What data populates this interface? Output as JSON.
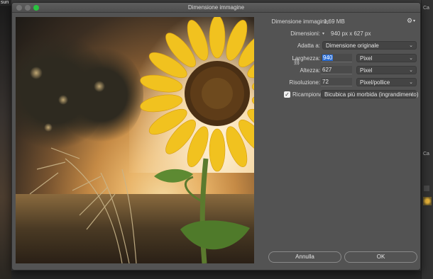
{
  "background": {
    "doc_tab": "sun",
    "right_panel": {
      "tab_top": "Ca",
      "tab_mid": "Ca"
    }
  },
  "dialog": {
    "title": "Dimensione immagine",
    "image_size": {
      "label": "Dimensione immagine:",
      "value": "1,69 MB"
    },
    "dimensions": {
      "label": "Dimensioni:",
      "value": "940 px x 627 px"
    },
    "fit_to": {
      "label": "Adatta a:",
      "selected": "Dimensione originale"
    },
    "width": {
      "label": "Larghezza:",
      "value": "940",
      "unit": "Pixel"
    },
    "height": {
      "label": "Altezza:",
      "value": "627",
      "unit": "Pixel"
    },
    "resolution": {
      "label": "Risoluzione:",
      "value": "72",
      "unit": "Pixel/pollice"
    },
    "resample": {
      "label": "Ricampiona:",
      "checked": true,
      "selected": "Bicubica più morbida (ingrandimento)"
    },
    "buttons": {
      "cancel": "Annulla",
      "ok": "OK"
    }
  },
  "icons": {
    "settings": "gear-icon",
    "link": "chain-link-icon",
    "dropdown": "chevron-down-icon"
  }
}
